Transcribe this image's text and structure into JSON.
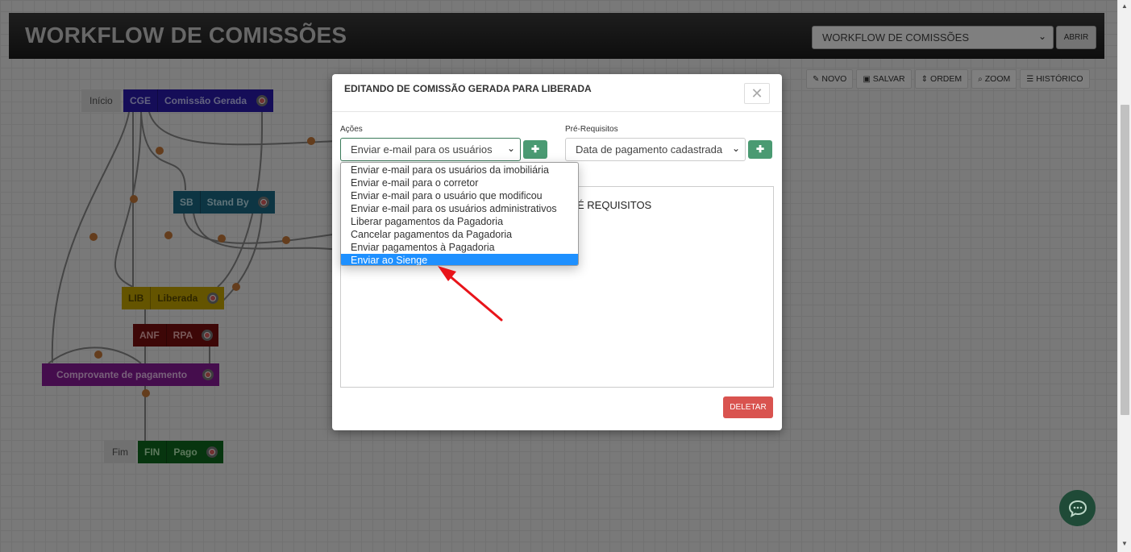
{
  "app": {
    "title": "WORKFLOW DE COMISSÕES",
    "workflow_select_value": "WORKFLOW DE COMISSÕES",
    "open_button": "ABRIR"
  },
  "toolbar": [
    {
      "icon": "pencil-icon",
      "glyph": "✎",
      "label": "NOVO"
    },
    {
      "icon": "save-icon",
      "glyph": "▣",
      "label": "SALVAR"
    },
    {
      "icon": "sort-icon",
      "glyph": "⇕",
      "label": "ORDEM"
    },
    {
      "icon": "zoom-icon",
      "glyph": "⌕",
      "label": "ZOOM"
    },
    {
      "icon": "list-icon",
      "glyph": "☰",
      "label": "HISTÓRICO"
    }
  ],
  "workflow": {
    "start_label": "Início",
    "end_label": "Fim",
    "nodes": [
      {
        "code": "CGE",
        "name": "Comissão Gerada",
        "color": "#2a1ab0"
      },
      {
        "code": "SB",
        "name": "Stand By",
        "color": "#1a6a86"
      },
      {
        "code": "LIB",
        "name": "Liberada",
        "color": "#c9a900"
      },
      {
        "code": "ANF",
        "name": "RPA",
        "color": "#7a0f0f"
      },
      {
        "code": "",
        "name": "Comprovante de pagamento",
        "color": "#8a1a9a"
      },
      {
        "code": "FIN",
        "name": "Pago",
        "color": "#0e6a1e"
      }
    ]
  },
  "modal": {
    "title": "EDITANDO DE COMISSÃO GERADA PARA LIBERADA",
    "close_glyph": "✕",
    "actions_label": "Ações",
    "actions_value": "Enviar e-mail para os usuários",
    "prereq_label": "Pré-Requisitos",
    "prereq_value": "Data de pagamento cadastrada",
    "add_glyph": "✚",
    "panel_heading_fragment": "É REQUISITOS",
    "delete_button": "DELETAR"
  },
  "actions_options": [
    "Enviar e-mail para os usuários da imobiliária",
    "Enviar e-mail para o corretor",
    "Enviar e-mail para o usuário que modificou",
    "Enviar e-mail para os usuários administrativos",
    "Liberar pagamentos da Pagadoria",
    "Cancelar pagamentos da Pagadoria",
    "Enviar pagamentos à Pagadoria",
    "Enviar ao Sienge"
  ],
  "selected_option": "Enviar ao Sienge",
  "colors": {
    "accent_green": "#4a9a72",
    "danger": "#d9534f",
    "selection_blue": "#1e90ff",
    "annotation_arrow": "#e8141a"
  }
}
